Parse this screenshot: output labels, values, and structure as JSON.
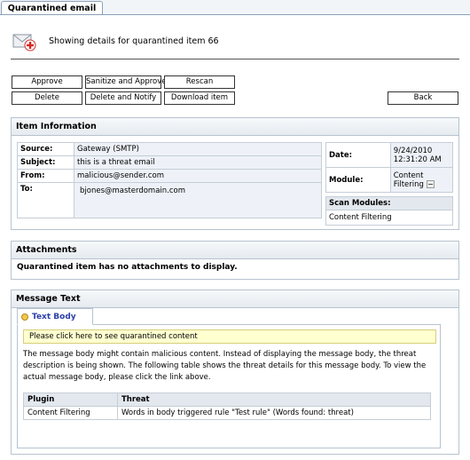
{
  "tab": {
    "label": "Quarantined email"
  },
  "header": {
    "text": "Showing details for quarantined item 66"
  },
  "buttons": {
    "approve": "Approve",
    "sanitize_approve": "Sanitize and Approve",
    "rescan": "Rescan",
    "delete": "Delete",
    "delete_notify": "Delete and Notify",
    "download": "Download item",
    "back": "Back"
  },
  "item_info": {
    "title": "Item Information",
    "rows": [
      {
        "label": "Source:",
        "value": "Gateway (SMTP)"
      },
      {
        "label": "Subject:",
        "value": "this is a threat email"
      },
      {
        "label": "From:",
        "value": "malicious@sender.com"
      },
      {
        "label": "To:",
        "value": "bjones@masterdomain.com"
      }
    ],
    "date_label": "Date:",
    "date_value": "9/24/2010",
    "time_value": "12:31:20 AM",
    "module_label": "Module:",
    "module_value": "Content Filtering",
    "scan_modules_label": "Scan Modules:",
    "scan_modules_value": "Content Filtering"
  },
  "attachments": {
    "title": "Attachments",
    "message": "Quarantined item has no attachments to display."
  },
  "message_text": {
    "title": "Message Text",
    "tab_label": "Text Body",
    "link_text": "Please click here to see quarantined content",
    "description": "The message body might contain malicious content. Instead of displaying the message body, the threat description is being shown. The following table shows the threat details for this message body. To view the actual message body, please click the link above.",
    "table": {
      "headers": [
        "Plugin",
        "Threat"
      ],
      "rows": [
        [
          "Content Filtering",
          "Words in body triggered rule \"Test rule\" (Words found: threat)"
        ]
      ]
    }
  }
}
